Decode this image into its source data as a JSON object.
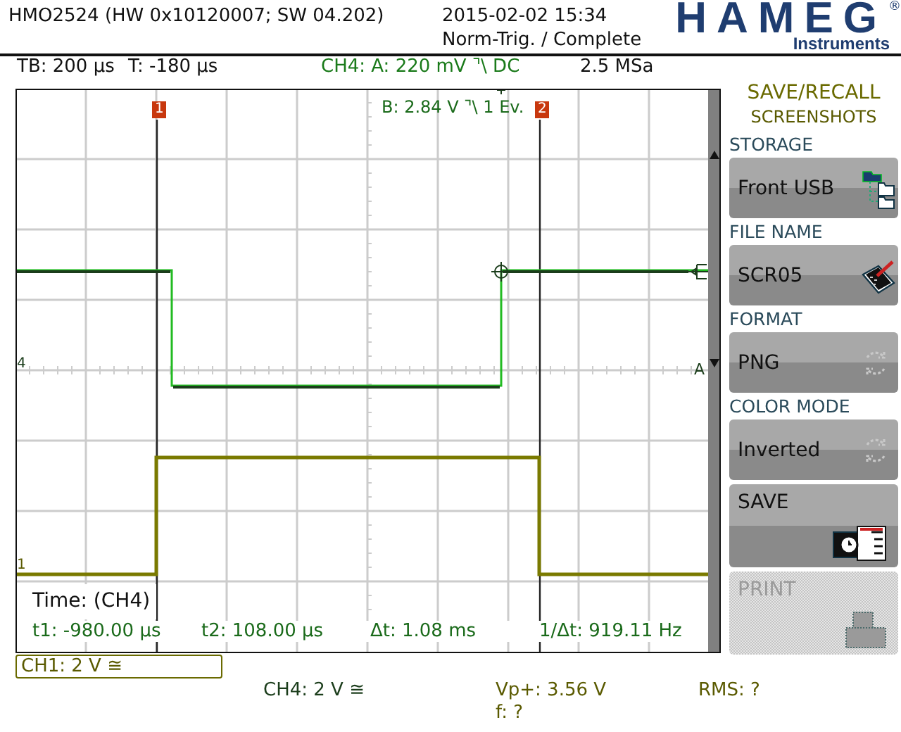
{
  "header": {
    "title": "HMO2524 (HW 0x10120007; SW 04.202)",
    "datetime": "2015-02-02 15:34",
    "trigger_status": "Norm-Trig. / Complete",
    "logo": {
      "brand": "HAMEG",
      "mark": "®",
      "tagline": "Instruments"
    }
  },
  "status_line": [
    {
      "text": "TB: 200 µs",
      "kind": "plain"
    },
    {
      "text": "T: -180 µs",
      "kind": "plain"
    },
    {
      "text": "CH4:  A: 220 mV ⌝\\ DC",
      "kind": "channel"
    },
    {
      "text": "2.5 MSa",
      "kind": "plain"
    }
  ],
  "screen": {
    "cursors": [
      {
        "label": "1"
      },
      {
        "label": "2"
      }
    ],
    "trigger_b": "B: 2.84 V ⌝\\ 1 Ev.",
    "left_markers": [
      "4",
      "1"
    ],
    "right_marker": "A",
    "measure_title": "Time: (CH4)",
    "measurements": [
      "t1: -980.00 µs",
      "t2: 108.00 µs",
      "Δt: 1.08 ms",
      "1/Δt: 919.11 Hz"
    ]
  },
  "menu": {
    "title": "SAVE/RECALL",
    "subtitle": "SCREENSHOTS",
    "items": [
      {
        "kind": "field",
        "label": "STORAGE",
        "value": "Front USB",
        "disabled": false
      },
      {
        "kind": "field",
        "label": "FILE NAME",
        "value": "SCR05",
        "disabled": false
      },
      {
        "kind": "field",
        "label": "FORMAT",
        "value": "PNG",
        "disabled": false
      },
      {
        "kind": "field",
        "label": "COLOR MODE",
        "value": "Inverted",
        "disabled": false
      },
      {
        "kind": "action",
        "label": "SAVE",
        "disabled": false
      },
      {
        "kind": "action",
        "label": "PRINT",
        "disabled": true
      }
    ]
  },
  "footer": {
    "active_channel": "CH1: 2 V ≅",
    "channel": "CH4: 2 V ≅",
    "measure_1": "Vp+: 3.56 V",
    "measure_2": "RMS: ?",
    "measure_3": "f: ?"
  }
}
